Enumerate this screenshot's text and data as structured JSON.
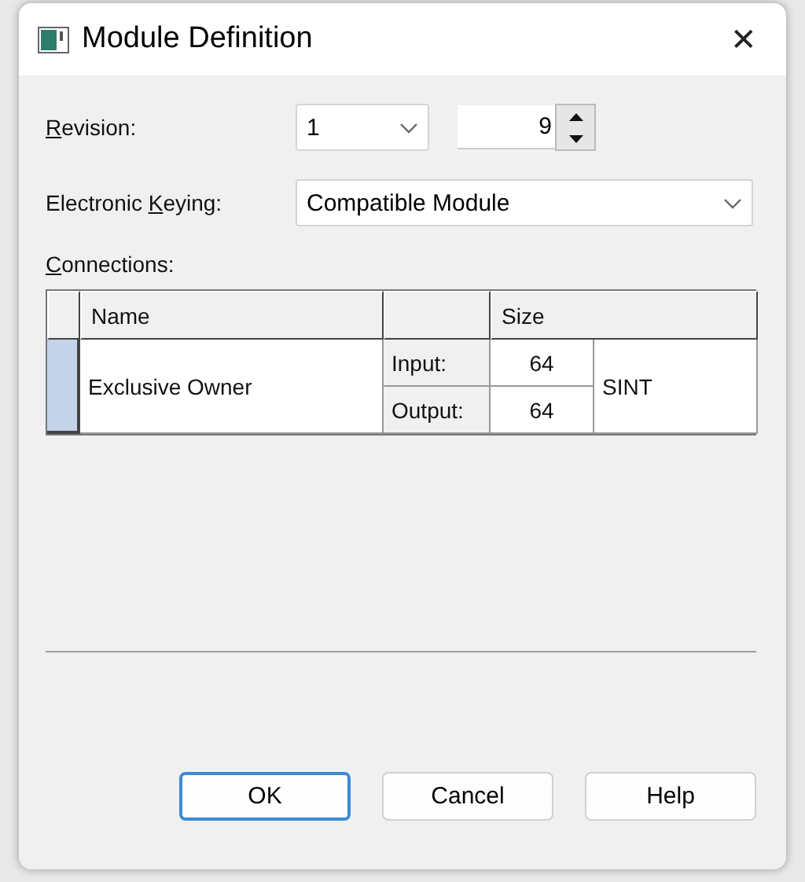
{
  "window": {
    "title": "Module Definition",
    "close": "✕"
  },
  "revision": {
    "label": {
      "access_key": "R",
      "after": "evision:"
    },
    "major": "1",
    "minor": "9"
  },
  "keying": {
    "label": {
      "before": "Electronic ",
      "access_key": "K",
      "after": "eying:"
    },
    "value": "Compatible Module"
  },
  "connections": {
    "label": {
      "access_key": "C",
      "after": "onnections:"
    },
    "columns": [
      "Name",
      "",
      "Size"
    ],
    "rows": [
      {
        "name": "Exclusive Owner",
        "selected": true,
        "sizes": [
          {
            "label": "Input:",
            "value": "64"
          },
          {
            "label": "Output:",
            "value": "64"
          }
        ],
        "type": "SINT"
      }
    ]
  },
  "buttons": [
    {
      "label": "OK",
      "default": true
    },
    {
      "label": "Cancel",
      "default": false
    },
    {
      "label": "Help",
      "default": false
    }
  ]
}
